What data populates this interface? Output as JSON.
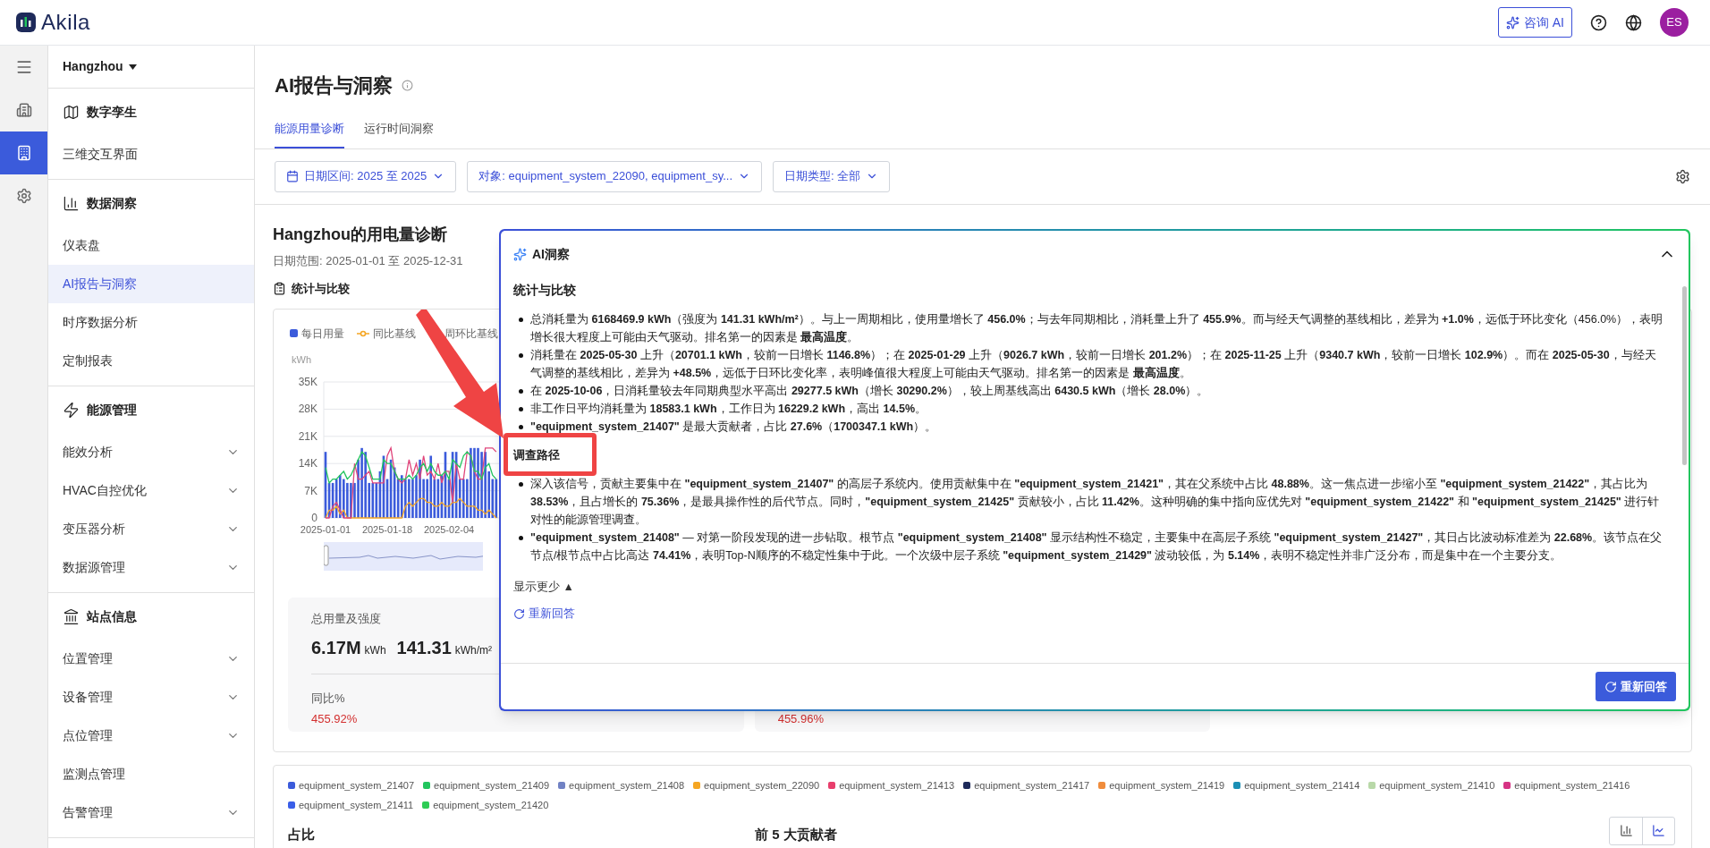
{
  "header": {
    "logo": "Akila",
    "ai_button": "咨询 AI",
    "avatar": "ES"
  },
  "rail": [
    {
      "kind": "menu",
      "selected": false
    },
    {
      "kind": "buildings",
      "selected": false
    },
    {
      "kind": "report",
      "selected": true
    },
    {
      "kind": "settings",
      "selected": false
    }
  ],
  "sidebar": {
    "location": "Hangzhou",
    "groups": [
      {
        "kind": "twin",
        "title": "数字孪生",
        "items": [
          {
            "label": "三维交互界面",
            "selected": false,
            "has_submenu": false
          }
        ]
      },
      {
        "kind": "insight",
        "title": "数据洞察",
        "items": [
          {
            "label": "仪表盘",
            "selected": false,
            "has_submenu": false
          },
          {
            "label": "AI报告与洞察",
            "selected": true,
            "has_submenu": false
          },
          {
            "label": "时序数据分析",
            "selected": false,
            "has_submenu": false
          },
          {
            "label": "定制报表",
            "selected": false,
            "has_submenu": false
          }
        ]
      },
      {
        "kind": "energy",
        "title": "能源管理",
        "items": [
          {
            "label": "能效分析",
            "selected": false,
            "has_submenu": true
          },
          {
            "label": "HVAC自控优化",
            "selected": false,
            "has_submenu": true
          },
          {
            "label": "变压器分析",
            "selected": false,
            "has_submenu": true
          },
          {
            "label": "数据源管理",
            "selected": false,
            "has_submenu": true
          }
        ]
      },
      {
        "kind": "site",
        "title": "站点信息",
        "items": [
          {
            "label": "位置管理",
            "selected": false,
            "has_submenu": true
          },
          {
            "label": "设备管理",
            "selected": false,
            "has_submenu": true
          },
          {
            "label": "点位管理",
            "selected": false,
            "has_submenu": true
          },
          {
            "label": "监测点管理",
            "selected": false,
            "has_submenu": false
          },
          {
            "label": "告警管理",
            "selected": false,
            "has_submenu": true
          }
        ]
      }
    ]
  },
  "page": {
    "title": "AI报告与洞察",
    "tabs": [
      {
        "label": "能源用量诊断",
        "selected": true
      },
      {
        "label": "运行时间洞察",
        "selected": false
      }
    ],
    "filters": [
      {
        "kind": "date",
        "label": "日期区间: 2025 至 2025"
      },
      {
        "kind": "select",
        "label": "对象: equipment_system_22090, equipment_sy..."
      },
      {
        "kind": "select",
        "label": "日期类型: 全部"
      }
    ]
  },
  "report": {
    "title": "Hangzhou的用电量诊断",
    "date_range": "日期范围: 2025-01-01 至 2025-12-31",
    "section": "统计与比较",
    "chart_data": {
      "type": "bar",
      "ylabel": "kWh",
      "categories": [
        "2025-01-01",
        null,
        null,
        null,
        null,
        null,
        null,
        null,
        null,
        null,
        null,
        null,
        null,
        null,
        null,
        null,
        null,
        "2025-01-18",
        null,
        null,
        null,
        null,
        null,
        null,
        null,
        null,
        null,
        null,
        null,
        null,
        null,
        null,
        null,
        null,
        "2025-02-04",
        null,
        null,
        null,
        null,
        null,
        null,
        null,
        null,
        null,
        null,
        null,
        null,
        null
      ],
      "yticks": [
        {
          "value": 0,
          "label": "0"
        },
        {
          "value": 7,
          "label": "7K"
        },
        {
          "value": 14,
          "label": "14K"
        },
        {
          "value": 21,
          "label": "21K"
        },
        {
          "value": 28,
          "label": "28K"
        },
        {
          "value": 35,
          "label": "35K"
        }
      ],
      "grid": true,
      "ylim": [
        0,
        35
      ],
      "series": [
        {
          "name": "每日用量",
          "color": "#3b5bdb",
          "values": [
            17,
            9,
            9,
            10,
            11,
            10,
            9,
            9,
            9,
            15,
            18,
            17,
            9,
            9,
            9,
            12,
            16,
            10,
            15,
            13,
            10,
            11,
            10,
            10,
            10,
            11,
            15,
            10,
            10,
            16,
            10,
            10,
            11,
            17,
            10,
            17,
            17,
            10,
            10,
            10,
            18,
            18,
            18,
            17,
            17,
            12,
            10,
            10
          ]
        },
        {
          "name": "同比基线",
          "type": "line",
          "color": "#f5a623",
          "values": [
            0,
            2,
            2,
            3,
            1,
            2,
            0,
            0,
            0,
            0,
            0,
            0,
            0,
            0,
            0,
            0,
            0,
            0,
            0,
            0,
            0,
            0,
            3,
            4,
            3,
            4,
            5,
            5,
            4,
            4,
            3,
            3,
            4,
            3,
            3,
            4,
            4,
            5,
            4,
            3,
            3,
            3,
            2,
            2,
            1,
            2,
            1,
            0
          ]
        },
        {
          "name": "周环比基线",
          "type": "line",
          "color": "#e0457b",
          "values": [
            0,
            0,
            3,
            4,
            2,
            0,
            0,
            0,
            14,
            10,
            10,
            11,
            12,
            9,
            9,
            9,
            9,
            16,
            18,
            12,
            10,
            9,
            10,
            15,
            11,
            14,
            10,
            16,
            11,
            12,
            10,
            14,
            9,
            12,
            12,
            4,
            14,
            10,
            10,
            17,
            16,
            12,
            10,
            10,
            18,
            18,
            18,
            17
          ]
        },
        {
          "type": "line",
          "color": "#22c55e",
          "values": [
            13,
            9,
            10,
            10,
            11,
            12,
            10,
            11,
            13,
            15,
            17,
            16,
            13,
            10,
            10,
            10,
            15,
            14,
            14,
            12,
            10,
            10,
            10,
            11,
            10,
            11,
            13,
            14,
            12,
            14,
            12,
            11,
            11,
            12,
            10,
            15,
            14,
            13,
            16,
            17,
            16,
            12,
            12,
            10,
            13,
            14,
            11,
            10
          ]
        }
      ]
    },
    "stat_cards": [
      {
        "title": "总用量及强度",
        "value": "6.17M",
        "unit": "kWh",
        "value_2": "141.31",
        "unit_2": "kWh/m²",
        "compare_label": "同比%",
        "compare_value": "455.92%"
      },
      {
        "compare_value": "455.96%"
      }
    ],
    "equipment_legend": [
      {
        "label": "equipment_system_21407",
        "color": "#3b5bdb"
      },
      {
        "label": "equipment_system_21409",
        "color": "#22c55e"
      },
      {
        "label": "equipment_system_21408",
        "color": "#7182c4"
      },
      {
        "label": "equipment_system_22090",
        "color": "#f5a623"
      },
      {
        "label": "equipment_system_21413",
        "color": "#e83e6c"
      },
      {
        "label": "equipment_system_21417",
        "color": "#1e2a5a"
      },
      {
        "label": "equipment_system_21419",
        "color": "#f08c3c"
      },
      {
        "label": "equipment_system_21414",
        "color": "#1b8fb5"
      },
      {
        "label": "equipment_system_21410",
        "color": "#b8d8a8"
      },
      {
        "label": "equipment_system_21416",
        "color": "#d63384"
      },
      {
        "label": "equipment_system_21411",
        "color": "#3a5ee8"
      },
      {
        "label": "equipment_system_21420",
        "color": "#2ecc55"
      }
    ],
    "share_title": "占比",
    "top_title": "前 5 大贡献者",
    "view_toggle": [
      {
        "kind": "bar",
        "selected": false
      },
      {
        "kind": "line",
        "selected": true
      }
    ]
  },
  "ai_panel": {
    "title": "AI洞察",
    "expanded": true,
    "sections": [
      {
        "title": "统计与比较",
        "bullets": [
          "总消耗量为 **6168469.9 kWh**（强度为 **141.31 kWh/m²**）。与上一周期相比，使用量增长了 **456.0%**；与去年同期相比，消耗量上升了 **455.9%**。而与经天气调整的基线相比，差异为 **+1.0%**，远低于环比变化（456.0%），表明增长很大程度上可能由天气驱动。排名第一的因素是 **最高温度**。",
          "消耗量在 **2025-05-30** 上升（**20701.1 kWh**，较前一日增长 **1146.8%**）；在 **2025-01-29** 上升（**9026.7 kWh**，较前一日增长 **201.2%**）；在 **2025-11-25** 上升（**9340.7 kWh**，较前一日增长 **102.9%**）。而在 **2025-05-30**，与经天气调整的基线相比，差异为 **+48.5%**，远低于日环比变化率，表明峰值很大程度上可能由天气驱动。排名第一的因素是 **最高温度**。",
          "在 **2025-10-06**，日消耗量较去年同期典型水平高出 **29277.5 kWh**（增长 **30290.2%**），较上周基线高出 **6430.5 kWh**（增长 **28.0%**）。",
          "非工作日平均消耗量为 **18583.1 kWh**，工作日为 **16229.2 kWh**，高出 **14.5%**。",
          "**\"equipment_system_21407\"** 是最大贡献者，占比 **27.6%**（**1700347.1 kWh**）。"
        ]
      },
      {
        "title": "调查路径",
        "bullets": [
          "深入该信号，贡献主要集中在 **\"equipment_system_21407\"** 的高层子系统内。使用贡献集中在 **\"equipment_system_21421\"**，其在父系统中占比 **48.88%**。这一焦点进一步缩小至 **\"equipment_system_21422\"**，其占比为 **38.53%**，且占增长的 **75.36%**，是最具操作性的后代节点。同时，**\"equipment_system_21425\"** 贡献较小，占比 **11.42%**。这种明确的集中指向应优先对 **\"equipment_system_21422\"** 和 **\"equipment_system_21425\"** 进行针对性的能源管理调查。",
          "**\"equipment_system_21408\"** — 对第一阶段发现的进一步钻取。根节点 **\"equipment_system_21408\"** 显示结构性不稳定，主要集中在高层子系统 **\"equipment_system_21427\"**，其日占比波动标准差为 **22.68%**。该节点在父节点/根节点中占比高达 **74.41%**，表明Top-N顺序的不稳定性集中于此。一个次级中层子系统 **\"equipment_system_21429\"** 波动较低，为 **5.14%**，表明不稳定性并非广泛分布，而是集中在一个主要分支。"
        ]
      }
    ],
    "toggle": "显示更少 ▲",
    "retry_link": "重新回答",
    "retry_button": "重新回答"
  }
}
